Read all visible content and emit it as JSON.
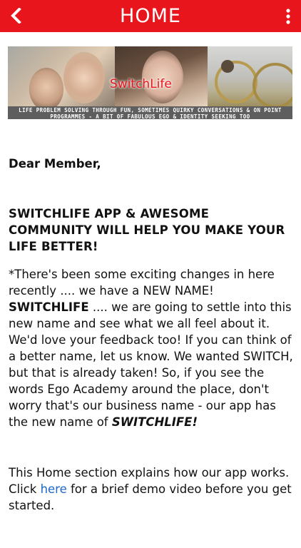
{
  "header": {
    "title": "HOME",
    "back_icon": "chevron-left-icon",
    "menu_icon": "vertical-dots-icon",
    "bar_color": "#e8151d"
  },
  "banner": {
    "brand_text": "SwitchLife",
    "tagline": "LIFE PROBLEM SOLVING THROUGH FUN, SOMETIMES QUIRKY CONVERSATIONS & ON POINT PROGRAMMES - A BIT OF FABULOUS EGO & IDENTITY SEEKING TOO"
  },
  "content": {
    "greeting": "Dear Member,",
    "headline": "SWITCHLIFE APP & AWESOME COMMUNITY WILL HELP YOU MAKE YOUR LIFE BETTER!",
    "intro_part1": "*There's been some exciting changes in here recently .... we have a NEW NAME! ",
    "intro_bold": "SWITCHLIFE",
    "intro_part2": " .... we are going to settle into this new name and see what we all feel about it. We'd love your feedback too! If you can think of a better name, let us know. We wanted SWITCH, but that is already taken! So, if you see the words Ego Academy around the place, don't worry that's our business name - our app has the new name of ",
    "intro_italic": "SWITCHLIFE!",
    "home_part1": "This Home section explains how our app works. Click ",
    "home_link": "here",
    "home_part2": " for a brief demo video before you get started."
  }
}
